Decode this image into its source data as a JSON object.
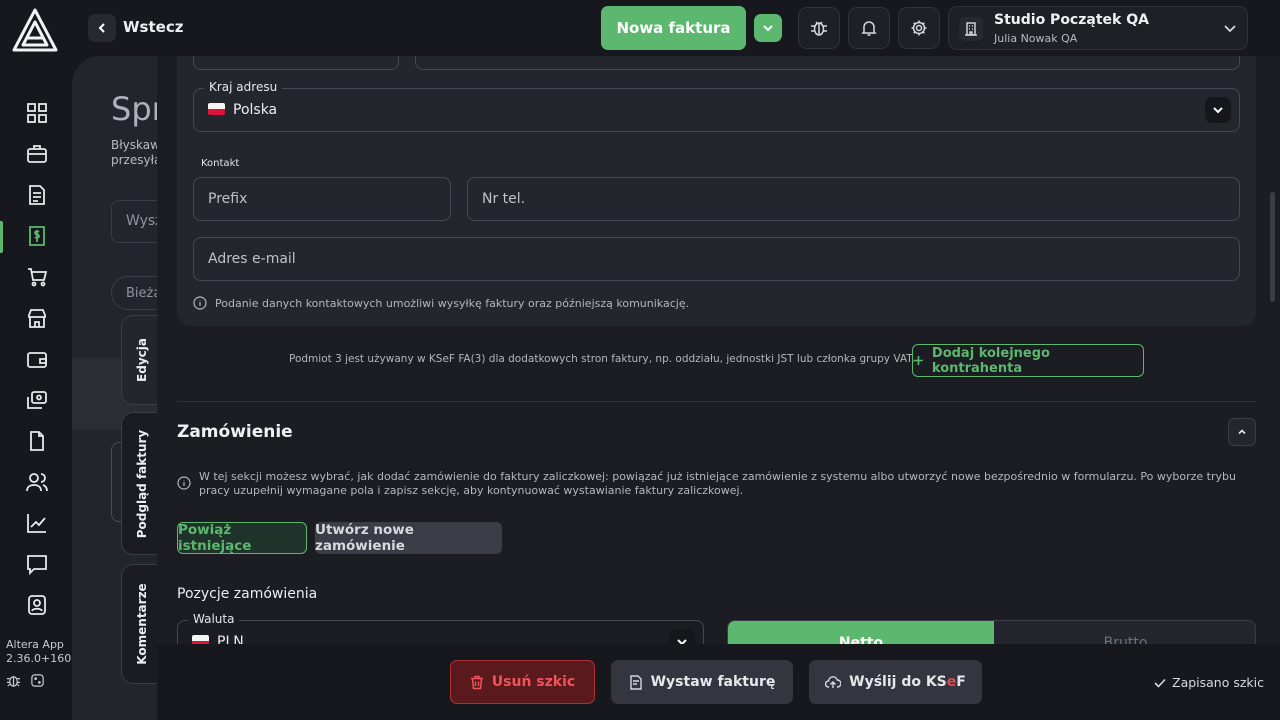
{
  "app": {
    "name": "Altera App",
    "version": "2.36.0+1602"
  },
  "header": {
    "back_label": "Wstecz",
    "new_invoice_label": "Nowa faktura",
    "org_name": "Studio Początek QA",
    "org_user": "Julia Nowak QA"
  },
  "background_page": {
    "title": "Spr",
    "subtitle_line1": "Błyskaw",
    "subtitle_line2": "przesyła",
    "search_placeholder": "Wysz",
    "filter_pill": "Bieżą"
  },
  "side_tabs": {
    "edit": "Edycja",
    "preview": "Podgląd faktury",
    "comments": "Komentarze"
  },
  "address": {
    "country_label": "Kraj adresu",
    "country_value": "Polska"
  },
  "contact": {
    "section_label": "Kontakt",
    "prefix_placeholder": "Prefix",
    "phone_placeholder": "Nr tel.",
    "email_placeholder": "Adres e-mail",
    "info_text": "Podanie danych kontaktowych umożliwi wysyłkę faktury oraz późniejszą komunikację."
  },
  "third_party": {
    "note": "Podmiot 3 jest używany w KSeF FA(3) dla dodatkowych stron faktury, np. oddziału, jednostki JST lub członka grupy VAT.",
    "add_button": "Dodaj kolejnego kontrahenta"
  },
  "order": {
    "title": "Zamówienie",
    "info_text": "W tej sekcji możesz wybrać, jak dodać zamówienie do faktury zaliczkowej: powiązać już istniejące zamówienie z systemu albo utworzyć nowe bezpośrednio w formularzu. Po wyborze trybu pracy uzupełnij wymagane pola i zapisz sekcję, aby kontynuować wystawianie faktury zaliczkowej.",
    "link_existing": "Powiąż istniejące",
    "create_new": "Utwórz nowe zamówienie",
    "items_title": "Pozycje zamówienia",
    "currency_label": "Waluta",
    "currency_value": "PLN",
    "netto": "Netto",
    "brutto": "Brutto"
  },
  "footer": {
    "delete_draft": "Usuń szkic",
    "issue_invoice": "Wystaw fakturę",
    "send_prefix": "Wyślij do KS",
    "send_e": "e",
    "send_suffix": "F",
    "saved_status": "Zapisano szkic"
  },
  "colors": {
    "accent": "#5cb86e",
    "danger": "#e5484d",
    "background": "#16181d"
  }
}
